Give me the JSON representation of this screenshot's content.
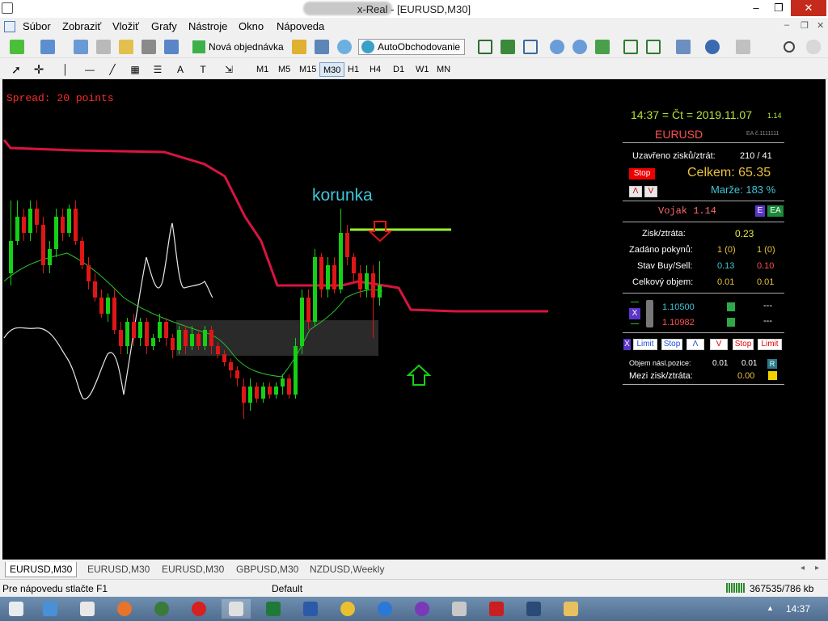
{
  "window": {
    "title": "x-Real - [EURUSD,M30]",
    "minimize": "–",
    "restore": "❐",
    "close": "✕"
  },
  "menu": [
    "Súbor",
    "Zobraziť",
    "Vložiť",
    "Grafy",
    "Nástroje",
    "Okno",
    "Nápoveda"
  ],
  "toolbar": {
    "new_order": "Nová objednávka",
    "auto_trading": "AutoObchodovanie"
  },
  "timeframes": [
    "M1",
    "M5",
    "M15",
    "M30",
    "H1",
    "H4",
    "D1",
    "W1",
    "MN"
  ],
  "active_timeframe": "M30",
  "chart": {
    "spread": "Spread: 20 points",
    "annotation": "korunka",
    "colors": {
      "bull": "#15d015",
      "bear": "#e01616",
      "ma": "#d8153f",
      "level": "#9bef2c",
      "arrow_down": "#e01616",
      "arrow_up": "#15d015"
    }
  },
  "panel": {
    "time": "14:37 = Čt = 2019.11.07",
    "version_small": "1.14",
    "symbol": "EURUSD",
    "ea_code": "EA č.1111111",
    "closed_label": "Uzavřeno zisků/ztrát:",
    "closed_value": "210 / 41",
    "stop_label": "Stop",
    "total": "Celkem: 65.35",
    "margin": "Marže:  183 %",
    "btn_up": "Λ",
    "btn_down": "V",
    "vojak": "Vojak 1.14",
    "badge_e": "E",
    "badge_ea": "EA",
    "profit_label": "Zisk/ztráta:",
    "profit_value": "0.23",
    "orders_label": "Zadáno pokynů:",
    "orders_buy": "1 (0)",
    "orders_sell": "1 (0)",
    "state_label": "Stav Buy/Sell:",
    "state_buy": "0.13",
    "state_sell": "0.10",
    "volume_label": "Celkový objem:",
    "volume_buy": "0.01",
    "volume_sell": "0.01",
    "price_buy": "1.10500",
    "price_sell": "1.10982",
    "dashes1": "---",
    "dashes2": "---",
    "btn_x_left": "X",
    "btn_x": "X",
    "btn_limit1": "Limit",
    "btn_stop1": "Stop",
    "btn_lambda": "Λ",
    "btn_v": "V",
    "btn_stop2": "Stop",
    "btn_limit2": "Limit",
    "next_pos_label": "Objem násl.pozice:",
    "next_pos_a": "0.01",
    "next_pos_b": "0.01",
    "r_label": "R",
    "between_label": "Mezi zisk/ztráta:",
    "between_value": "0.00"
  },
  "tabs": [
    "EURUSD,M30",
    "EURUSD,M30",
    "EURUSD,M30",
    "GBPUSD,M30",
    "NZDUSD,Weekly"
  ],
  "status": {
    "help": "Pre nápovedu stlačte F1",
    "profile": "Default",
    "traffic": "367535/786 kb"
  },
  "taskbar": {
    "clock": "14:37"
  }
}
